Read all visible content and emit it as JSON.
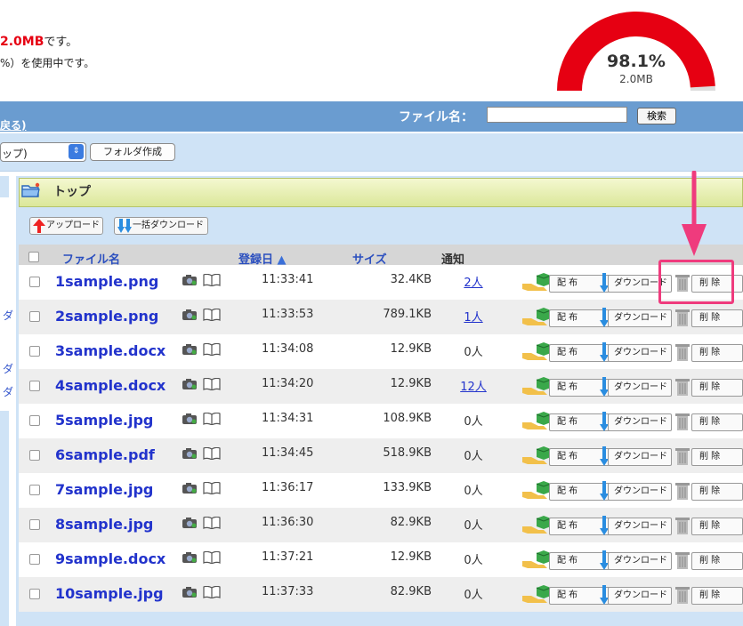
{
  "usage": {
    "line1_value": "2.0MB",
    "line1_suffix": "です。",
    "line2": "%）を使用中です。"
  },
  "gauge": {
    "percent_text": "98.1%",
    "percent_value": 98.1,
    "size_text": "2.0MB",
    "color": "#e60012"
  },
  "search": {
    "back_link": "戻る)",
    "label": "ファイル名：",
    "input_value": "",
    "button": "検索"
  },
  "folder_bar": {
    "select_value": "ップ)",
    "create_button": "フォルダ作成"
  },
  "sidebar": {
    "chars": [
      "ダ",
      "ダ",
      "ダ"
    ]
  },
  "folder": {
    "title": "トップ",
    "upload_button": "アップロード",
    "bulk_download_button": "一括ダウンロード"
  },
  "table": {
    "headers": {
      "name": "ファイル名",
      "date": "登録日",
      "size": "サイズ",
      "notify": "通知"
    },
    "sort_indicator": "▲",
    "actions": {
      "distribute": "配 布",
      "download": "ダウンロード",
      "delete": "削 除"
    },
    "rows": [
      {
        "name": "1sample.png",
        "time": "11:33:41",
        "size": "32.4KB",
        "notify": "2人",
        "notify_link": true
      },
      {
        "name": "2sample.png",
        "time": "11:33:53",
        "size": "789.1KB",
        "notify": "1人",
        "notify_link": true
      },
      {
        "name": "3sample.docx",
        "time": "11:34:08",
        "size": "12.9KB",
        "notify": "0人",
        "notify_link": false
      },
      {
        "name": "4sample.docx",
        "time": "11:34:20",
        "size": "12.9KB",
        "notify": "12人",
        "notify_link": true
      },
      {
        "name": "5sample.jpg",
        "time": "11:34:31",
        "size": "108.9KB",
        "notify": "0人",
        "notify_link": false
      },
      {
        "name": "6sample.pdf",
        "time": "11:34:45",
        "size": "518.9KB",
        "notify": "0人",
        "notify_link": false
      },
      {
        "name": "7sample.jpg",
        "time": "11:36:17",
        "size": "133.9KB",
        "notify": "0人",
        "notify_link": false
      },
      {
        "name": "8sample.jpg",
        "time": "11:36:30",
        "size": "82.9KB",
        "notify": "0人",
        "notify_link": false
      },
      {
        "name": "9sample.docx",
        "time": "11:37:21",
        "size": "12.9KB",
        "notify": "0人",
        "notify_link": false
      },
      {
        "name": "10sample.jpg",
        "time": "11:37:33",
        "size": "82.9KB",
        "notify": "0人",
        "notify_link": false
      }
    ]
  },
  "annotation": {
    "highlight_color": "#ef3b7d"
  }
}
